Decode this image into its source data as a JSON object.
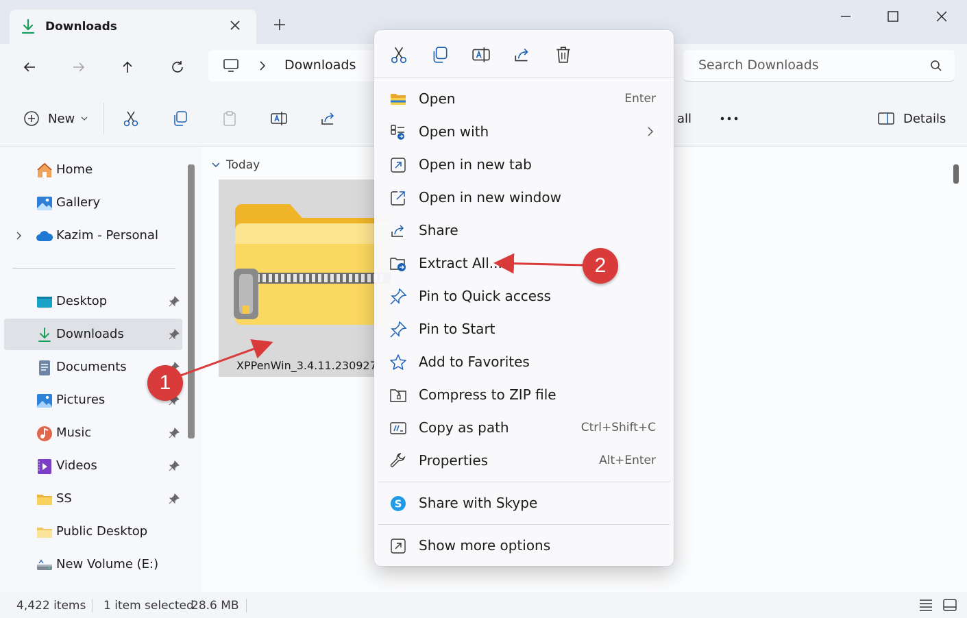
{
  "tab": {
    "title": "Downloads"
  },
  "address": {
    "crumb": "Downloads"
  },
  "search": {
    "placeholder": "Search Downloads"
  },
  "commandbar": {
    "new_label": "New",
    "select_all_fragment": "all",
    "details_label": "Details"
  },
  "sidebar": {
    "top_items": [
      {
        "label": "Home"
      },
      {
        "label": "Gallery"
      },
      {
        "label": "Kazim - Personal"
      }
    ],
    "pinned_items": [
      {
        "label": "Desktop"
      },
      {
        "label": "Downloads"
      },
      {
        "label": "Documents"
      },
      {
        "label": "Pictures"
      },
      {
        "label": "Music"
      },
      {
        "label": "Videos"
      },
      {
        "label": "SS"
      },
      {
        "label": "Public Desktop"
      },
      {
        "label": "New Volume (E:)"
      }
    ]
  },
  "content": {
    "group_label": "Today",
    "file_name": "XPPenWin_3.4.11.230927"
  },
  "status": {
    "item_count": "4,422 items",
    "selection": "1 item selected",
    "size": "28.6 MB"
  },
  "context_menu": {
    "items": [
      {
        "label": "Open",
        "shortcut": "Enter"
      },
      {
        "label": "Open with",
        "shortcut": ""
      },
      {
        "label": "Open in new tab",
        "shortcut": ""
      },
      {
        "label": "Open in new window",
        "shortcut": ""
      },
      {
        "label": "Share",
        "shortcut": ""
      },
      {
        "label": "Extract All...",
        "shortcut": ""
      },
      {
        "label": "Pin to Quick access",
        "shortcut": ""
      },
      {
        "label": "Pin to Start",
        "shortcut": ""
      },
      {
        "label": "Add to Favorites",
        "shortcut": ""
      },
      {
        "label": "Compress to ZIP file",
        "shortcut": ""
      },
      {
        "label": "Copy as path",
        "shortcut": "Ctrl+Shift+C"
      },
      {
        "label": "Properties",
        "shortcut": "Alt+Enter"
      }
    ],
    "skype_label": "Share with Skype",
    "more_label": "Show more options"
  },
  "annotations": {
    "step1": "1",
    "step2": "2"
  },
  "colors": {
    "accent": "#0067c0",
    "annotation": "#d93a3a",
    "folder": "#f5c443"
  }
}
